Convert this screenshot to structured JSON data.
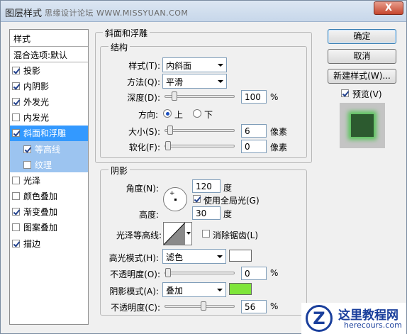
{
  "window": {
    "title": "图层样式",
    "watermark": "思缘设计论坛  WWW.MISSYUAN.COM",
    "close_label": "X"
  },
  "left_panel": {
    "header": "样式",
    "blend_options": "混合选项:默认",
    "items": [
      {
        "label": "投影",
        "checked": true
      },
      {
        "label": "内阴影",
        "checked": true
      },
      {
        "label": "外发光",
        "checked": true
      },
      {
        "label": "内发光",
        "checked": false
      },
      {
        "label": "斜面和浮雕",
        "checked": true,
        "selected": true
      },
      {
        "label": "等高线",
        "checked": true,
        "sub": true
      },
      {
        "label": "纹理",
        "checked": false,
        "sub": true
      },
      {
        "label": "光泽",
        "checked": false
      },
      {
        "label": "颜色叠加",
        "checked": false
      },
      {
        "label": "渐变叠加",
        "checked": true
      },
      {
        "label": "图案叠加",
        "checked": false
      },
      {
        "label": "描边",
        "checked": true
      }
    ]
  },
  "bevel": {
    "title": "斜面和浮雕",
    "structure": {
      "title": "结构",
      "style_label": "样式(T):",
      "style_value": "内斜面",
      "technique_label": "方法(Q):",
      "technique_value": "平滑",
      "depth_label": "深度(D):",
      "depth_value": "100",
      "depth_unit": "%",
      "depth_slider": 0.1,
      "direction_label": "方向:",
      "direction_up": "上",
      "direction_down": "下",
      "size_label": "大小(S):",
      "size_value": "6",
      "size_unit": "像素",
      "size_slider": 0.03,
      "soften_label": "软化(F):",
      "soften_value": "0",
      "soften_unit": "像素",
      "soften_slider": 0.0
    },
    "shading": {
      "title": "阴影",
      "angle_label": "角度(N):",
      "angle_value": "120",
      "angle_unit": "度",
      "global_light_label": "使用全局光(G)",
      "global_light_checked": true,
      "altitude_label": "高度:",
      "altitude_value": "30",
      "altitude_unit": "度",
      "gloss_label": "光泽等高线:",
      "antialias_label": "消除锯齿(L)",
      "antialias_checked": false,
      "highlight_label": "高光模式(H):",
      "highlight_value": "滤色",
      "highlight_color": "#ffffff",
      "highlight_opacity_label": "不透明度(O):",
      "highlight_opacity_value": "0",
      "highlight_opacity_unit": "%",
      "highlight_opacity_slider": 0.0,
      "shadow_label": "阴影模式(A):",
      "shadow_value": "叠加",
      "shadow_color": "#7fe53a",
      "shadow_opacity_label": "不透明度(C):",
      "shadow_opacity_value": "56",
      "shadow_opacity_unit": "%",
      "shadow_opacity_slider": 0.56
    }
  },
  "buttons": {
    "ok": "确定",
    "cancel": "取消",
    "new_style": "新建样式(W)...",
    "preview_label": "预览(V)",
    "preview_checked": true
  },
  "logo": {
    "mark": "Z",
    "title": "这里教程网",
    "url": "herecours.com"
  }
}
